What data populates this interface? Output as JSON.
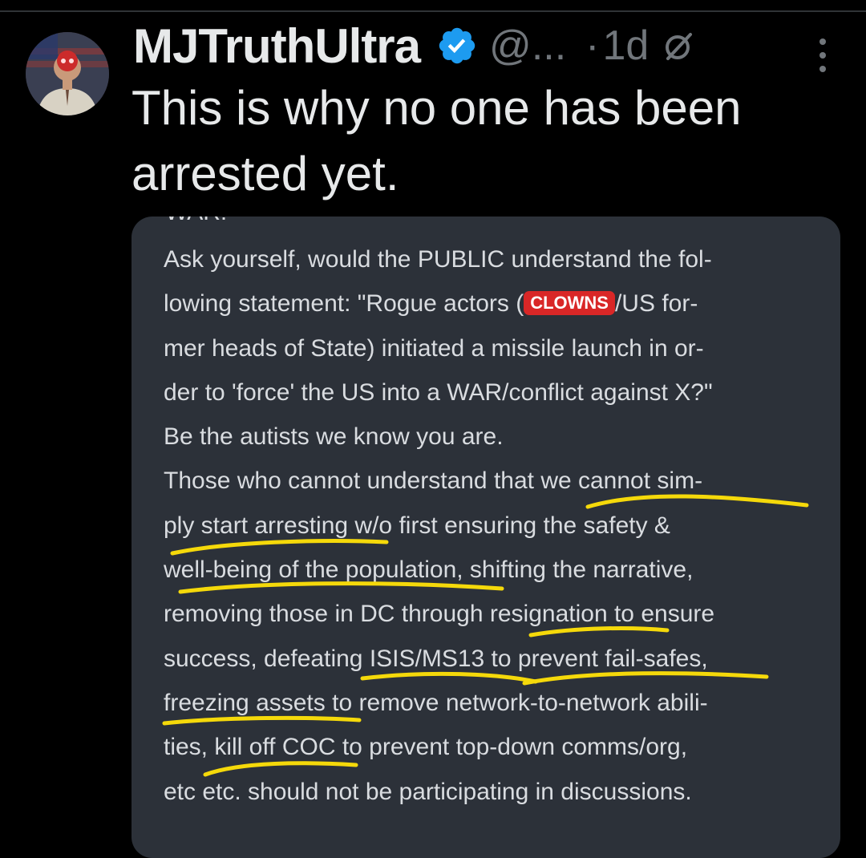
{
  "post": {
    "display_name": "MJTruthUltra",
    "handle": "@...",
    "separator": "·",
    "time": "1d",
    "text_line1": "This is why no one has been",
    "text_line2": "arrested yet."
  },
  "icons": {
    "avatar": "avatar-photo",
    "verified": "verified-badge-icon",
    "grok": "grok-icon",
    "more": "more-options-icon"
  },
  "colors": {
    "background": "#000000",
    "card": "#2c3139",
    "verified_blue": "#1d9bf0",
    "highlight_yellow": "#f5d90a",
    "tag_red": "#d92727",
    "muted_text": "#71767b"
  },
  "media": {
    "cut_top": "WAR!",
    "line1": "Ask yourself, would the PUBLIC understand the fol-",
    "line2_a": "lowing statement: \"Rogue actors (",
    "tag": "CLOWNS",
    "line2_b": "/US for-",
    "line3": "mer heads of State) initiated a missile launch in or-",
    "line4": "der to 'force' the US into a WAR/conflict against X?\"",
    "line5": "Be the autists we know you are.",
    "line6": "Those who cannot understand that we cannot sim-",
    "line7": "ply start arresting w/o first ensuring the safety &",
    "line8": "well-being of the population, shifting the narrative,",
    "line9": "removing those in DC through resignation to ensure",
    "line10": "success, defeating ISIS/MS13 to prevent fail-safes,",
    "line11": "freezing assets to remove network-to-network abili-",
    "line12": "ties, kill off COC to prevent top-down comms/org,",
    "line13": "etc etc. should not be participating in discussions."
  }
}
